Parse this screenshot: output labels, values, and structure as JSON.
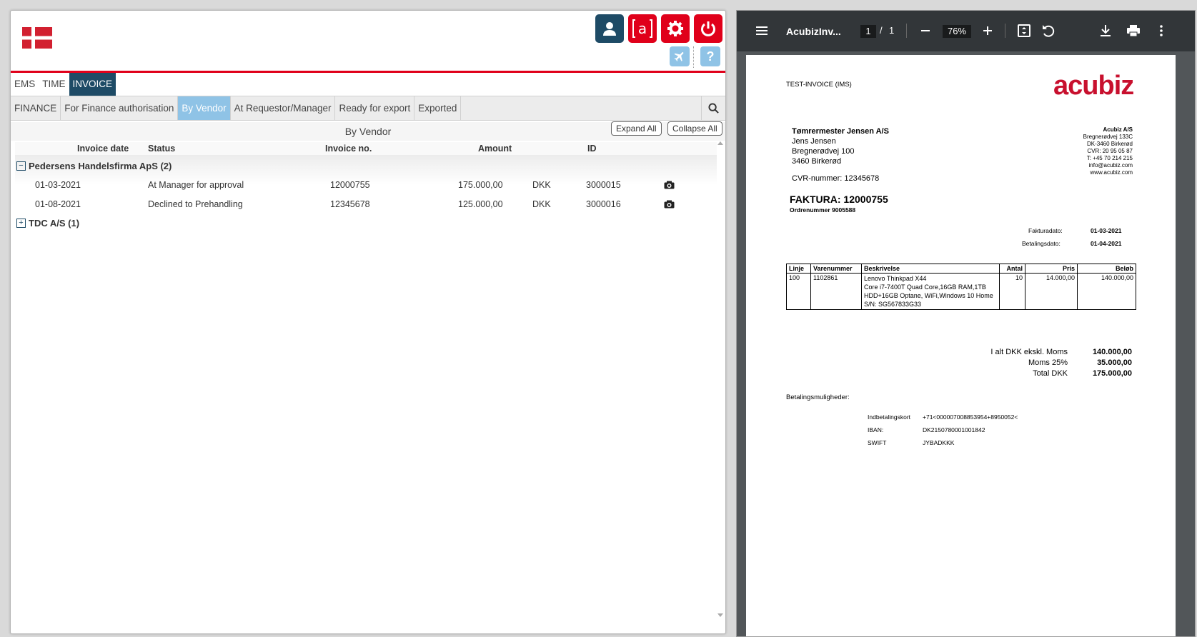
{
  "header": {
    "buttons": [
      "user-icon",
      "acubiz-icon",
      "gear-icon",
      "power-icon",
      "plane-icon",
      "help-icon"
    ],
    "help_label": "?"
  },
  "nav": {
    "main_tabs": [
      "EMS",
      "TIME",
      "INVOICE"
    ],
    "active_main": "INVOICE",
    "sub_tabs": [
      "FINANCE",
      "For Finance authorisation",
      "By Vendor",
      "At Requestor/Manager",
      "Ready for export",
      "Exported"
    ],
    "active_sub": "By Vendor"
  },
  "view": {
    "title": "By Vendor",
    "expand_all": "Expand All",
    "collapse_all": "Collapse All"
  },
  "table": {
    "columns": [
      "Invoice date",
      "Status",
      "Invoice no.",
      "Amount",
      "ID"
    ],
    "groups": [
      {
        "name": "Pedersens Handelsfirma ApS (2)",
        "expanded": true,
        "toggle": "−",
        "rows": [
          {
            "date": "01-03-2021",
            "status": "At Manager for approval",
            "invoice_no": "12000755",
            "amount": "175.000,00",
            "currency": "DKK",
            "id": "3000015"
          },
          {
            "date": "01-08-2021",
            "status": "Declined to Prehandling",
            "invoice_no": "12345678",
            "amount": "125.000,00",
            "currency": "DKK",
            "id": "3000016"
          }
        ]
      },
      {
        "name": "TDC A/S (1)",
        "expanded": false,
        "toggle": "+",
        "rows": []
      }
    ]
  },
  "pdf": {
    "title": "AcubizInv...",
    "page_current": "1",
    "page_sep": "/",
    "page_total": "1",
    "zoom": "76%",
    "doc": {
      "label": "TEST-INVOICE (IMS)",
      "logo": "acubiz",
      "recipient": [
        "Tømrermester Jensen A/S",
        "Jens Jensen",
        "Bregnerødvej 100",
        "3460 Birkerød"
      ],
      "cvr": "CVR-nummer: 12345678",
      "sender": [
        "Acubiz A/S",
        "Bregnerødvej 133C",
        "DK-3460 Birkerød",
        "CVR: 20 95 05 87",
        "T: +45 70 214 215",
        "info@acubiz.com",
        "www.acubiz.com"
      ],
      "faktura": "FAKTURA: 12000755",
      "ordre": "Ordrenummer 9005588",
      "fakturadato_label": "Fakturadato:",
      "fakturadato": "01-03-2021",
      "betalingsdato_label": "Betalingsdato:",
      "betalingsdato": "01-04-2021",
      "line_headers": [
        "Linje",
        "Varenummer",
        "Beskrivelse",
        "Antal",
        "Pris",
        "Beløb"
      ],
      "line": {
        "linje": "100",
        "varenummer": "1102861",
        "beskrivelse": [
          "Lenovo Thinkpad X44",
          "Core i7-7400T Quad Core,16GB RAM,1TB",
          "HDD+16GB Optane, WiFi,Windows 10 Home",
          "S/N: SG567833G33"
        ],
        "antal": "10",
        "pris": "14.000,00",
        "beloeb": "140.000,00"
      },
      "totals": [
        {
          "label": "I alt DKK ekskl. Moms",
          "value": "140.000,00"
        },
        {
          "label": "Moms 25%",
          "value": "35.000,00"
        },
        {
          "label": "Total DKK",
          "value": "175.000,00"
        }
      ],
      "payment_title": "Betalingsmuligheder:",
      "payment": [
        {
          "label": "Indbetalingskort",
          "value": "+71<000007008853954+8950052<"
        },
        {
          "label": "IBAN:",
          "value": "DK2150780001001842"
        },
        {
          "label": "SWIFT",
          "value": "JYBADKKK"
        }
      ]
    }
  },
  "colors": {
    "brand_red": "#e0001a",
    "navy": "#1e4b66",
    "light_blue": "#8fc3e6",
    "pdf_toolbar": "#323639"
  }
}
